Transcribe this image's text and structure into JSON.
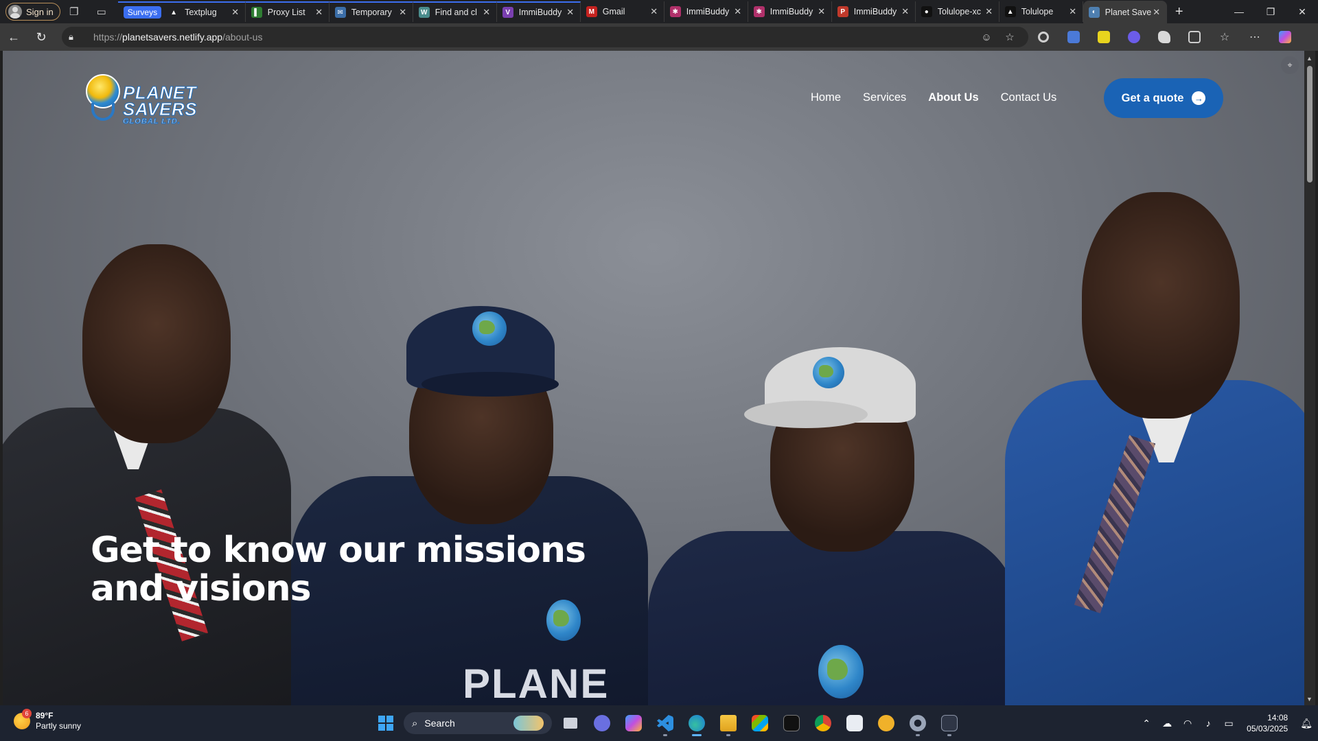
{
  "browser": {
    "signin_label": "Sign in",
    "tab_group_label": "Surveys",
    "tabs": [
      {
        "title": "Textplug",
        "color": "#202124",
        "glyph": "▲"
      },
      {
        "title": "Proxy List",
        "color": "#2e7d32",
        "glyph": "▌"
      },
      {
        "title": "Temporary",
        "color": "#3b6ea8",
        "glyph": "✉"
      },
      {
        "title": "Find and cl",
        "color": "#4a8c8c",
        "glyph": "W"
      },
      {
        "title": "ImmiBuddy",
        "color": "#7a3fb0",
        "glyph": "V"
      },
      {
        "title": "Gmail",
        "color": "#c5221f",
        "glyph": "M"
      },
      {
        "title": "ImmiBuddy",
        "color": "#b0306a",
        "glyph": "✱"
      },
      {
        "title": "ImmiBuddy",
        "color": "#b0306a",
        "glyph": "✱"
      },
      {
        "title": "ImmiBuddy",
        "color": "#c0392b",
        "glyph": "P"
      },
      {
        "title": "Tolulope-xc",
        "color": "#111111",
        "glyph": "●"
      },
      {
        "title": "Tolulope",
        "color": "#111111",
        "glyph": "▲"
      },
      {
        "title": "Planet Save",
        "color": "#4e7fb0",
        "glyph": "◐"
      }
    ],
    "active_tab_index": 11,
    "url_prefix": "https://",
    "url_host": "planetsavers.netlify.app",
    "url_path": "/about-us"
  },
  "site": {
    "logo_line1": "PLANET SAVERS",
    "logo_line2": "GLOBAL LTD.",
    "nav": [
      "Home",
      "Services",
      "About Us",
      "Contact Us"
    ],
    "current_nav": "About Us",
    "quote_button": "Get a quote",
    "hero_title": "Get to know our missions and visions",
    "shirt_text": "PLANE"
  },
  "taskbar": {
    "weather_temp": "89°F",
    "weather_desc": "Partly sunny",
    "weather_badge": "6",
    "search_label": "Search",
    "time": "14:08",
    "date": "05/03/2025"
  },
  "colors": {
    "accent": "#1a63b5",
    "tab_group": "#3b6ef0"
  }
}
